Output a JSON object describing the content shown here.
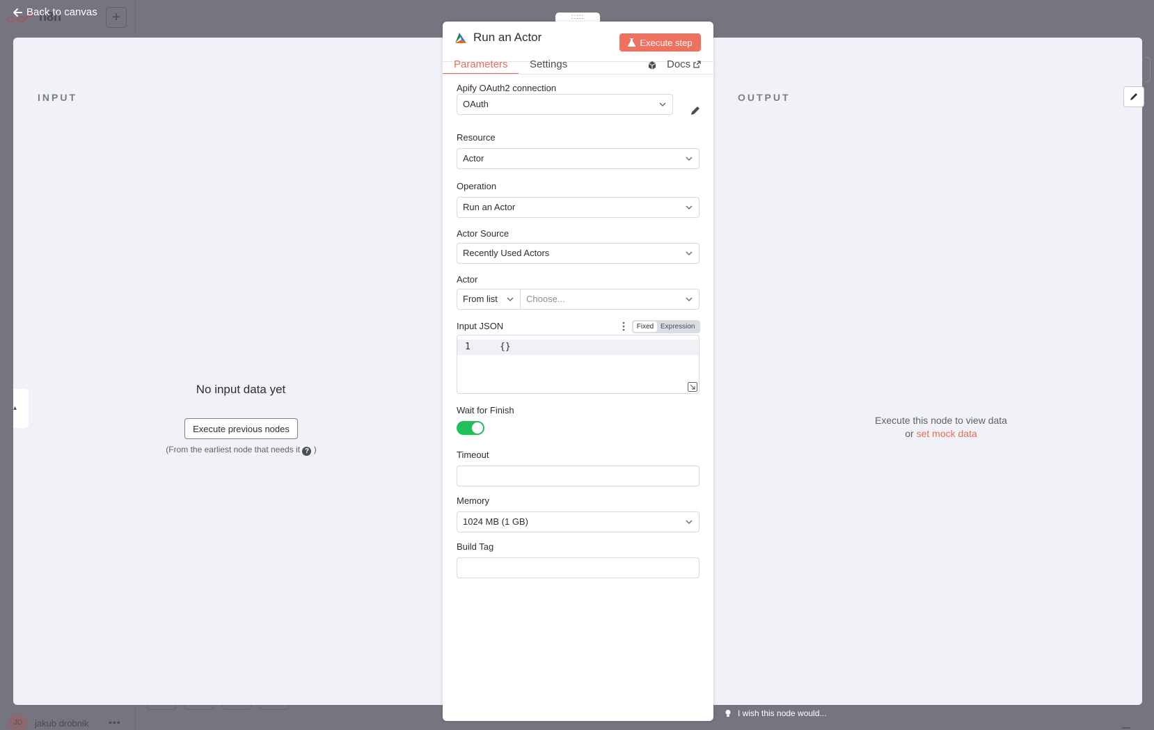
{
  "app": {
    "back_label": "Back to canvas",
    "bg_brand": "n8n",
    "user_initials": "JD",
    "user_name": "jakub drobnik"
  },
  "input_pane": {
    "label": "INPUT",
    "empty_title": "No input data yet",
    "execute_previous_label": "Execute previous nodes",
    "hint_prefix": "(From the earliest node that needs it",
    "hint_suffix": ")"
  },
  "output_pane": {
    "label": "OUTPUT",
    "message_line1": "Execute this node to view data",
    "message_or": "or",
    "mock_link": "set mock data"
  },
  "node": {
    "title": "Run an Actor",
    "execute_label": "Execute step",
    "tabs": [
      "Parameters",
      "Settings"
    ],
    "docs_label": "Docs",
    "fields": {
      "credential": {
        "label": "Apify OAuth2 connection",
        "value": "OAuth"
      },
      "resource": {
        "label": "Resource",
        "value": "Actor"
      },
      "operation": {
        "label": "Operation",
        "value": "Run an Actor"
      },
      "actor_source": {
        "label": "Actor Source",
        "value": "Recently Used Actors"
      },
      "actor": {
        "label": "Actor",
        "mode": "From list",
        "placeholder": "Choose..."
      },
      "input_json": {
        "label": "Input JSON",
        "toggle_fixed": "Fixed",
        "toggle_expression": "Expression",
        "line_number": "1",
        "code": "{}"
      },
      "wait_for_finish": {
        "label": "Wait for Finish",
        "enabled": true
      },
      "timeout": {
        "label": "Timeout",
        "value": ""
      },
      "memory": {
        "label": "Memory",
        "value": "1024 MB (1 GB)"
      },
      "build_tag": {
        "label": "Build Tag",
        "value": ""
      }
    }
  },
  "feedback": {
    "label": "I wish this node would..."
  },
  "colors": {
    "accent": "#ea6c53",
    "execute_button": "#ef7160",
    "toggle_on": "#20c05b",
    "overlay": "#75757f",
    "pane_background": "#f0f2f7"
  }
}
